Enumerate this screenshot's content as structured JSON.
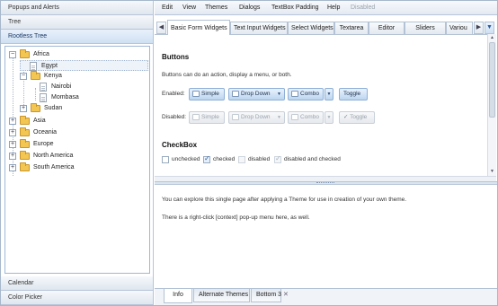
{
  "left": {
    "accordion_top": [
      "Popups and Alerts",
      "Tree",
      "Rootless Tree"
    ],
    "accordion_bottom": [
      "Calendar",
      "Color Picker"
    ],
    "tree": {
      "africa": "Africa",
      "egypt": "Egypt",
      "kenya": "Kenya",
      "nairobi": "Nairobi",
      "mombasa": "Mombasa",
      "sudan": "Sudan",
      "asia": "Asia",
      "oceania": "Oceania",
      "europe": "Europe",
      "north_america": "North America",
      "south_america": "South America"
    }
  },
  "menu": {
    "items": [
      "Edit",
      "View",
      "Themes",
      "Dialogs",
      "TextBox Padding",
      "Help",
      "Disabled"
    ]
  },
  "tabs": {
    "items": [
      "Basic Form Widgets",
      "Text Input Widgets",
      "Select Widgets",
      "Textarea",
      "Editor",
      "Sliders",
      "Variou"
    ]
  },
  "buttons_section": {
    "title": "Buttons",
    "description": "Buttons can do an action, display a menu, or both.",
    "enabled_label": "Enabled:",
    "disabled_label": "Disabled:",
    "simple": "Simple",
    "drop_down": "Drop Down",
    "combo": "Combo",
    "toggle": "Toggle"
  },
  "checkbox_section": {
    "title": "CheckBox",
    "unchecked": "unchecked",
    "checked": "checked",
    "disabled": "disabled",
    "disabled_checked": "disabled and checked"
  },
  "bottom_panel": {
    "line1": "You can explore this single page after applying a Theme for use in creation of your own theme.",
    "line2": "There is a right-click [context] pop-up menu here, as well."
  },
  "bottom_tabs": [
    "Info",
    "Alternate Themes",
    "Bottom 3"
  ],
  "colors": {
    "accent": "#bdd5f0",
    "border": "#b6c5d8",
    "folder": "#f3c653"
  }
}
